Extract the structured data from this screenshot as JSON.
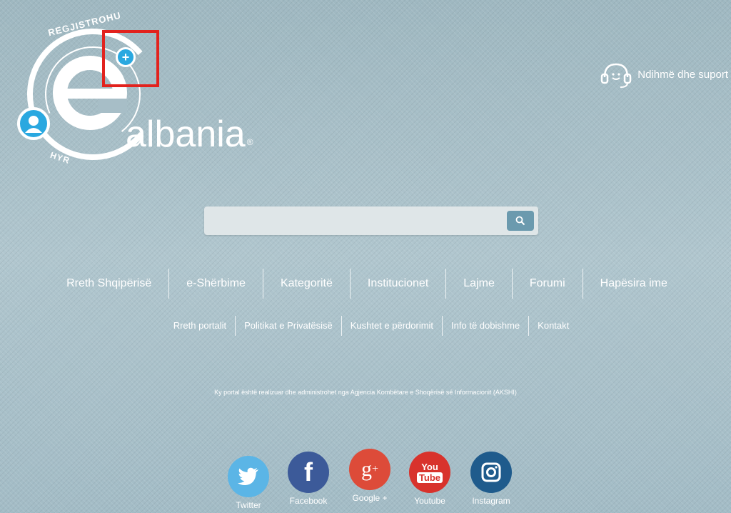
{
  "header": {
    "brand": "albania",
    "register_label": "REGJISTROHU",
    "login_label": "HYR",
    "help_label": "Ndihmë dhe suport"
  },
  "search": {
    "placeholder": "",
    "value": ""
  },
  "main_nav": [
    {
      "label": "Rreth Shqipërisë"
    },
    {
      "label": "e-Shërbime"
    },
    {
      "label": "Kategoritë"
    },
    {
      "label": "Institucionet"
    },
    {
      "label": "Lajme"
    },
    {
      "label": "Forumi"
    },
    {
      "label": "Hapësira ime"
    }
  ],
  "sub_nav": [
    {
      "label": "Rreth portalit"
    },
    {
      "label": "Politikat e Privatësisë"
    },
    {
      "label": "Kushtet e përdorimit"
    },
    {
      "label": "Info të dobishme"
    },
    {
      "label": "Kontakt"
    }
  ],
  "footer_note": "Ky portal është realizuar dhe administrohet nga Agjencia Kombëtare e Shoqërisë së Informacionit (AKSHI)",
  "social": [
    {
      "label": "Twitter",
      "icon": "twitter-icon",
      "color": "#5bb5e6"
    },
    {
      "label": "Facebook",
      "icon": "facebook-icon",
      "color": "#3c5a99"
    },
    {
      "label": "Google +",
      "icon": "google-plus-icon",
      "color": "#dd4b39"
    },
    {
      "label": "Youtube",
      "icon": "youtube-icon",
      "color": "#d8322c"
    },
    {
      "label": "Instagram",
      "icon": "instagram-icon",
      "color": "#1f5b8c"
    }
  ],
  "colors": {
    "accent": "#2aa8e0",
    "highlight": "#e2221d",
    "background": "#a7bec7"
  }
}
